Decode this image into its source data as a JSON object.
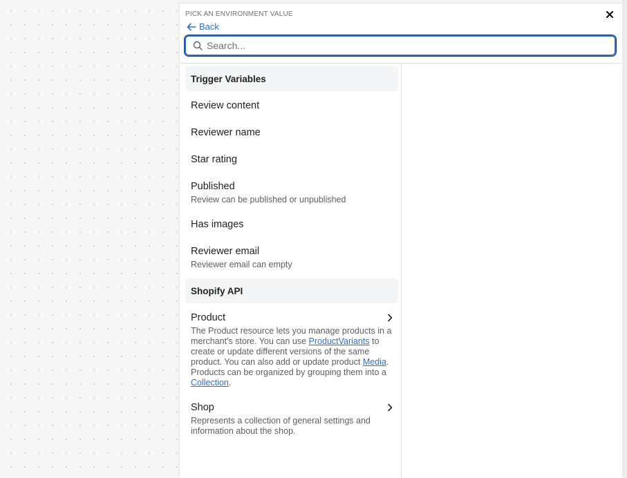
{
  "panel": {
    "header_label": "PICK AN ENVIRONMENT VALUE",
    "back_label": "Back",
    "search_placeholder": "Search..."
  },
  "sections": [
    {
      "title": "Trigger Variables",
      "items": [
        {
          "title": "Review content"
        },
        {
          "title": "Reviewer name"
        },
        {
          "title": "Star rating"
        },
        {
          "title": "Published",
          "desc": "Review can be published or unpublished"
        },
        {
          "title": "Has images"
        },
        {
          "title": "Reviewer email",
          "desc": "Reviewer email can empty"
        }
      ]
    },
    {
      "title": "Shopify API",
      "items": [
        {
          "title": "Product",
          "desc_parts": {
            "p1": "The Product resource lets you manage products in a merchant's store. You can use ",
            "link1": "ProductVariants",
            "p2": " to create or update different versions of the same product. You can also add or update product ",
            "link2": "Media",
            "p3": ". Products can be organized by grouping them into a ",
            "link3": "Collection",
            "p4": "."
          }
        },
        {
          "title": "Shop",
          "desc": "Represents a collection of general settings and information about the shop."
        }
      ]
    }
  ],
  "colors": {
    "accent": "#2c6ecb",
    "section_bg": "#f4f5f6"
  },
  "icons": [
    "close-icon",
    "arrow-left-icon",
    "search-icon",
    "chevron-right-icon"
  ]
}
